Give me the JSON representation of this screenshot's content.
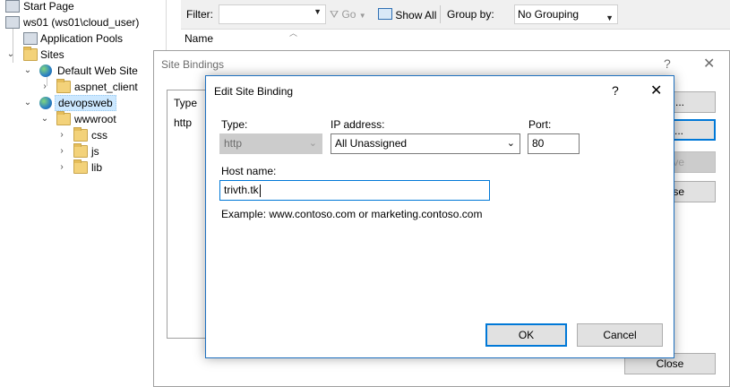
{
  "tree": {
    "items": [
      {
        "label": "Start Page"
      },
      {
        "label": "ws01 (ws01\\cloud_user)"
      },
      {
        "label": "Application Pools"
      },
      {
        "label": "Sites"
      },
      {
        "label": "Default Web Site"
      },
      {
        "label": "aspnet_client"
      },
      {
        "label": "devopsweb"
      },
      {
        "label": "wwwroot"
      },
      {
        "label": "css"
      },
      {
        "label": "js"
      },
      {
        "label": "lib"
      }
    ]
  },
  "filterbar": {
    "filter_label": "Filter:",
    "go_label": "Go",
    "show_all_label": "Show All",
    "group_by_label": "Group by:",
    "group_by_value": "No Grouping"
  },
  "main": {
    "name_header": "Name"
  },
  "site_bindings": {
    "title": "Site Bindings",
    "help": "?",
    "close_x": "✕",
    "columns": [
      "Type"
    ],
    "rows": [
      [
        "http"
      ]
    ],
    "side_buttons": [
      "...",
      "...",
      "ve",
      "se"
    ],
    "close_button": "Close"
  },
  "edit_binding": {
    "title": "Edit Site Binding",
    "help": "?",
    "close_x": "✕",
    "type_label": "Type:",
    "type_value": "http",
    "ip_label": "IP address:",
    "ip_value": "All Unassigned",
    "port_label": "Port:",
    "port_value": "80",
    "host_label": "Host name:",
    "host_value": "trivth.tk",
    "example": "Example: www.contoso.com or marketing.contoso.com",
    "ok_label": "OK",
    "cancel_label": "Cancel"
  }
}
